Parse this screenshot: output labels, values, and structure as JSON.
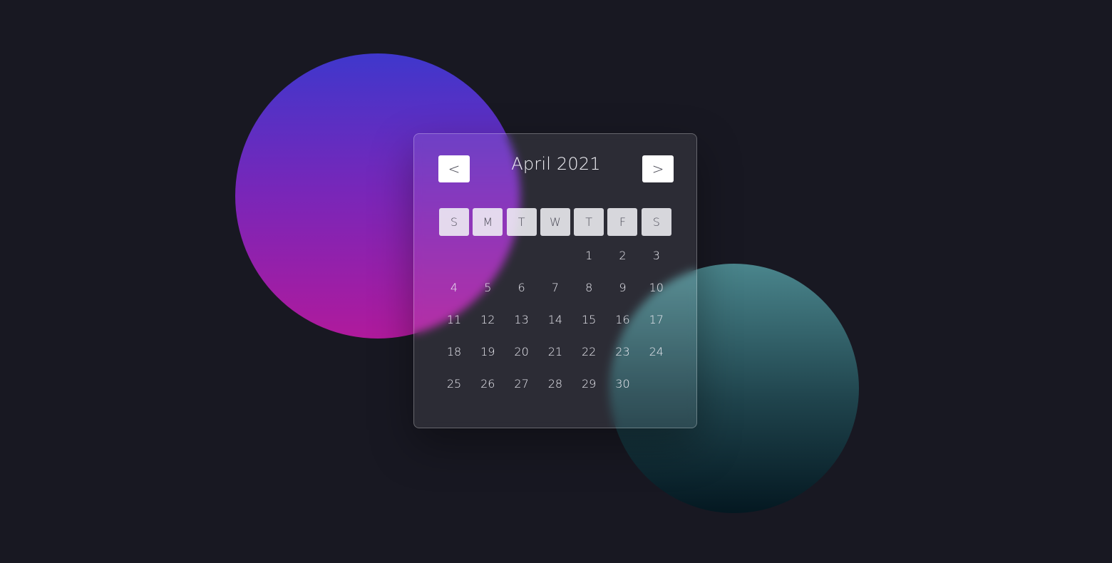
{
  "calendar": {
    "title": "April 2021",
    "prev_label": "<",
    "next_label": ">",
    "weekdays": [
      "S",
      "M",
      "T",
      "W",
      "T",
      "F",
      "S"
    ],
    "weeks": [
      [
        "",
        "",
        "",
        "",
        "1",
        "2",
        "3"
      ],
      [
        "4",
        "5",
        "6",
        "7",
        "8",
        "9",
        "10"
      ],
      [
        "11",
        "12",
        "13",
        "14",
        "15",
        "16",
        "17"
      ],
      [
        "18",
        "19",
        "20",
        "21",
        "22",
        "23",
        "24"
      ],
      [
        "25",
        "26",
        "27",
        "28",
        "29",
        "30",
        ""
      ]
    ]
  },
  "colors": {
    "background": "#181822",
    "purple_blob_top": "#3f37cc",
    "purple_blob_bottom": "#b01a9c",
    "teal_blob_top": "#4a858c",
    "teal_blob_bottom": "#041821"
  }
}
